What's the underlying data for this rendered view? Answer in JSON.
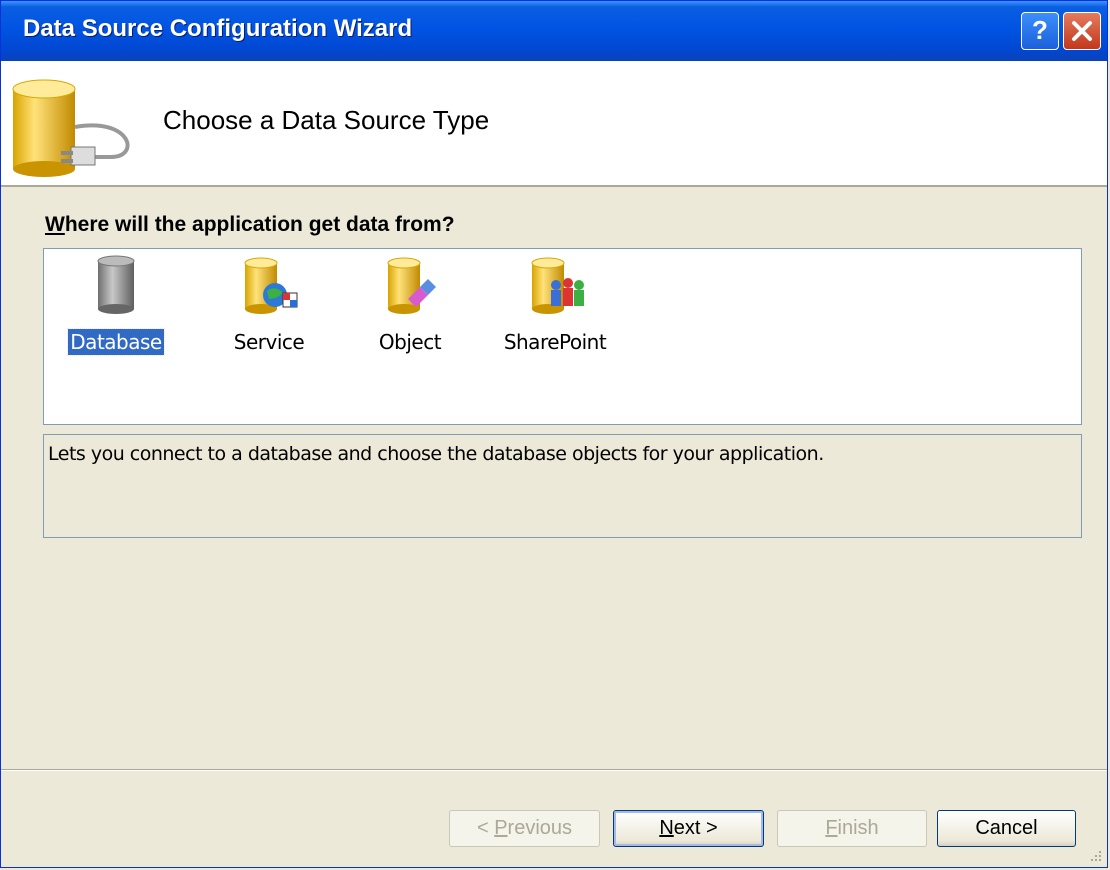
{
  "window": {
    "title": "Data Source Configuration Wizard",
    "help_button": "?",
    "close_button": "close"
  },
  "header": {
    "title": "Choose a Data Source Type",
    "icon": "database-plug-icon"
  },
  "question": {
    "accelerator": "W",
    "rest": "here will the application get data from?"
  },
  "items": [
    {
      "label": "Database",
      "icon": "database-icon",
      "selected": true
    },
    {
      "label": "Service",
      "icon": "service-icon",
      "selected": false
    },
    {
      "label": "Object",
      "icon": "object-icon",
      "selected": false
    },
    {
      "label": "SharePoint",
      "icon": "sharepoint-icon",
      "selected": false
    }
  ],
  "description": "Lets you connect to a database and choose the database objects for your application.",
  "buttons": {
    "previous": {
      "prefix": "< ",
      "accel": "P",
      "rest": "revious",
      "enabled": false
    },
    "next": {
      "prefix": "",
      "accel": "N",
      "rest": "ext >",
      "enabled": true
    },
    "finish": {
      "prefix": "",
      "accel": "F",
      "rest": "inish",
      "enabled": false
    },
    "cancel": {
      "label": "Cancel",
      "enabled": true
    }
  },
  "colors": {
    "titlebar": "#0054e3",
    "selection": "#316ac5",
    "dialog_bg": "#ece9d8"
  }
}
